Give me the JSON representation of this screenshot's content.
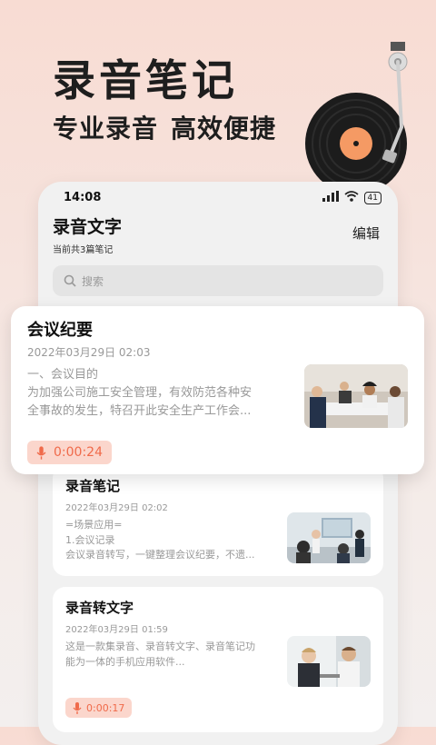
{
  "hero": {
    "title": "录音笔记",
    "subtitle_1": "专业录音",
    "subtitle_2": "高效便捷"
  },
  "status_bar": {
    "time": "14:08",
    "battery": "41",
    "hd_label": "HD"
  },
  "app": {
    "title": "录音文字",
    "count_text": "当前共3篇笔记",
    "edit_label": "编辑",
    "search_placeholder": "搜索"
  },
  "notes": [
    {
      "title": "会议纪要",
      "date": "2022年03月29日 02:03",
      "excerpt_1": "一、会议目的",
      "excerpt_2": "为加强公司施工安全管理，有效防范各种安",
      "excerpt_3": "全事故的发生，特召开此安全生产工作会...",
      "duration": "0:00:24"
    },
    {
      "title": "录音笔记",
      "date": "2022年03月29日 02:02",
      "excerpt_1": "=场景应用=",
      "excerpt_2": "1.会议记录",
      "excerpt_3": "会议录音转写，一键整理会议纪要，不遗..."
    },
    {
      "title": "录音转文字",
      "date": "2022年03月29日 01:59",
      "excerpt_1": "这是一款集录音、录音转文字、录音笔记功",
      "excerpt_2": "能为一体的手机应用软件...",
      "duration": "0:00:17"
    }
  ],
  "colors": {
    "accent": "#f06a4a",
    "duration_bg": "#fbd6cc",
    "background_top": "#f8dcd3"
  }
}
